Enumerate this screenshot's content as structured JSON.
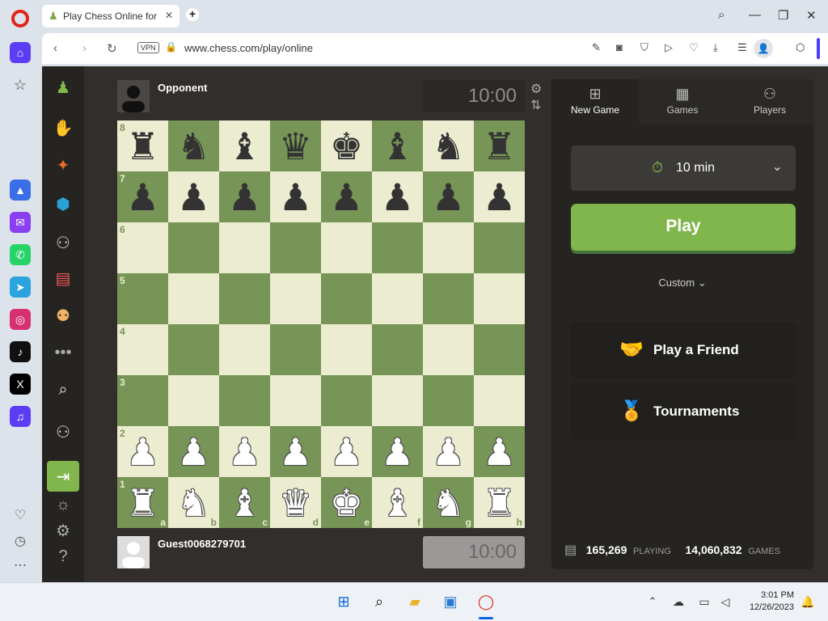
{
  "browser": {
    "tab_title": "Play Chess Online for",
    "url": "www.chess.com/play/online",
    "vpn_label": "VPN"
  },
  "chess": {
    "opponent": {
      "name": "Opponent",
      "clock": "10:00"
    },
    "me": {
      "name": "Guest0068279701",
      "clock": "10:00"
    },
    "board": [
      [
        "bR",
        "bN",
        "bB",
        "bQ",
        "bK",
        "bB",
        "bN",
        "bR"
      ],
      [
        "bP",
        "bP",
        "bP",
        "bP",
        "bP",
        "bP",
        "bP",
        "bP"
      ],
      [
        "",
        "",
        "",
        "",
        "",
        "",
        "",
        ""
      ],
      [
        "",
        "",
        "",
        "",
        "",
        "",
        "",
        ""
      ],
      [
        "",
        "",
        "",
        "",
        "",
        "",
        "",
        ""
      ],
      [
        "",
        "",
        "",
        "",
        "",
        "",
        "",
        ""
      ],
      [
        "wP",
        "wP",
        "wP",
        "wP",
        "wP",
        "wP",
        "wP",
        "wP"
      ],
      [
        "wR",
        "wN",
        "wB",
        "wQ",
        "wK",
        "wB",
        "wN",
        "wR"
      ]
    ],
    "ranks": [
      "8",
      "7",
      "6",
      "5",
      "4",
      "3",
      "2",
      "1"
    ],
    "files": [
      "a",
      "b",
      "c",
      "d",
      "e",
      "f",
      "g",
      "h"
    ],
    "colors": {
      "light": "#ebecd0",
      "dark": "#779556",
      "accent": "#81b64c"
    }
  },
  "panel": {
    "tabs": [
      {
        "label": "New Game",
        "icon": "plus-square-icon"
      },
      {
        "label": "Games",
        "icon": "chessboard-icon"
      },
      {
        "label": "Players",
        "icon": "players-icon"
      }
    ],
    "time_control": "10 min",
    "play_label": "Play",
    "custom_label": "Custom",
    "play_friend_label": "Play a Friend",
    "tournaments_label": "Tournaments",
    "stats": {
      "playing_count": "165,269",
      "playing_label": "PLAYING",
      "games_count": "14,060,832",
      "games_label": "GAMES"
    }
  },
  "taskbar": {
    "time": "3:01 PM",
    "date": "12/26/2023"
  }
}
